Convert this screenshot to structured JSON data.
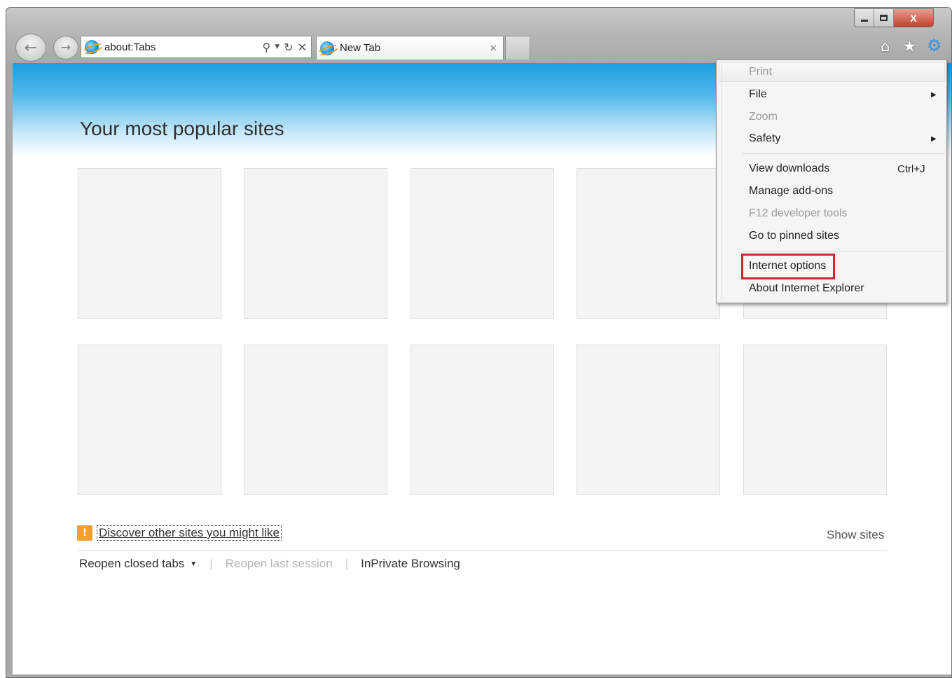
{
  "window": {
    "caption": {
      "minimize": "minimize",
      "maximize": "maximize",
      "close_label": "X"
    }
  },
  "nav": {
    "address": "about:Tabs",
    "tab_label": "New Tab",
    "tab_close": "×"
  },
  "content": {
    "title": "Your most popular sites",
    "tiles_count": 10,
    "discover_link": "Discover other sites you might like",
    "show_sites": "Show sites",
    "bottom_links": {
      "reopen_closed": "Reopen closed tabs",
      "reopen_session": "Reopen last session",
      "inprivate": "InPrivate Browsing"
    }
  },
  "menu": {
    "items": [
      {
        "label": "Print"
      },
      {
        "label": "File"
      },
      {
        "label": "Zoom"
      },
      {
        "label": "Safety"
      },
      {
        "label": "View downloads",
        "shortcut": "Ctrl+J"
      },
      {
        "label": "Manage add-ons"
      },
      {
        "label": "F12 developer tools"
      },
      {
        "label": "Go to pinned sites"
      },
      {
        "label": "Internet options"
      },
      {
        "label": "About Internet Explorer"
      }
    ],
    "highlight_color": "#d0262d"
  },
  "colors": {
    "banner_blue": "#1a9fe0",
    "gear_blue": "#3a8fd8"
  }
}
